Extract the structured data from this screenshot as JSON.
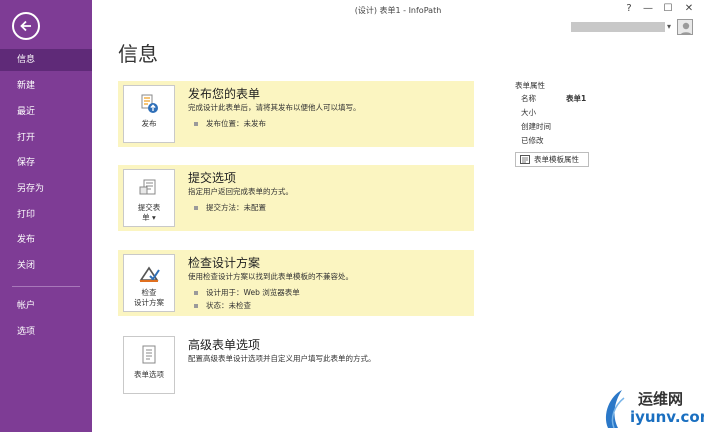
{
  "window": {
    "title": "(设计) 表单1 - InfoPath",
    "help_label": "?",
    "minimize_label": "—",
    "restore_label": "☐",
    "close_label": "✕"
  },
  "sidebar": {
    "accent": "#7e3c95",
    "items": [
      {
        "label": "信息",
        "active": true
      },
      {
        "label": "新建"
      },
      {
        "label": "最近"
      },
      {
        "label": "打开"
      },
      {
        "label": "保存"
      },
      {
        "label": "另存为"
      },
      {
        "label": "打印"
      },
      {
        "label": "发布"
      },
      {
        "label": "关闭"
      },
      {
        "label": "帐户"
      },
      {
        "label": "选项"
      }
    ]
  },
  "page": {
    "title": "信息"
  },
  "cards": [
    {
      "button_label": "发布",
      "heading": "发布您的表单",
      "description": "完成设计此表单后，请将其发布以便他人可以填写。",
      "bullets": [
        "发布位置：未发布"
      ]
    },
    {
      "button_label_line1": "提交表",
      "button_label_line2": "单 ▾",
      "heading": "提交选项",
      "description": "指定用户返回完成表单的方式。",
      "bullets": [
        "提交方法：未配置"
      ]
    },
    {
      "button_label_line1": "检查",
      "button_label_line2": "设计方案",
      "heading": "检查设计方案",
      "description": "使用检查设计方案以找到此表单模板的不兼容处。",
      "bullets": [
        "设计用于：Web 浏览器表单",
        "状态：未检查"
      ]
    },
    {
      "button_label": "表单选项",
      "heading": "高级表单选项",
      "description": "配置高级表单设计选项并自定义用户填写此表单的方式。",
      "bullets": []
    }
  ],
  "properties": {
    "title": "表单属性",
    "rows": [
      {
        "label": "名称",
        "value": "表单1"
      },
      {
        "label": "大小",
        "value": ""
      },
      {
        "label": "创建时间",
        "value": ""
      },
      {
        "label": "已修改",
        "value": ""
      }
    ],
    "template_button_label": "表单模板属性"
  },
  "watermark": {
    "line1": "运维网",
    "line2": "iyunv.com"
  }
}
